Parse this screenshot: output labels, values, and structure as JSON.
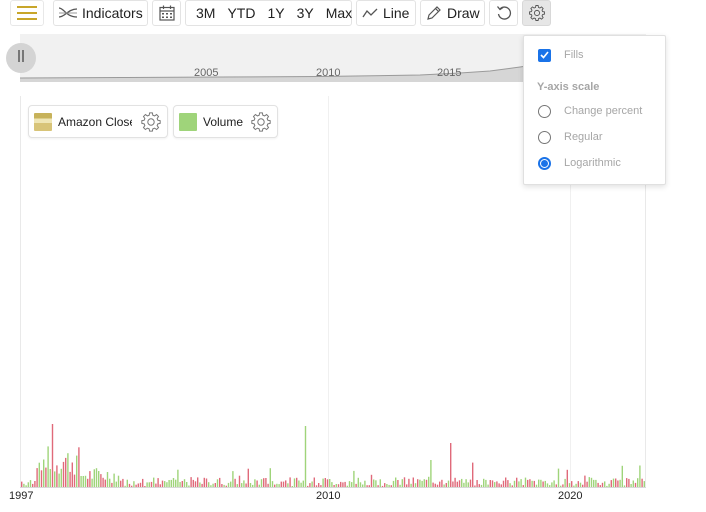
{
  "toolbar": {
    "indicators_label": "Indicators",
    "ranges": [
      "3M",
      "YTD",
      "1Y",
      "3Y",
      "Max"
    ],
    "line_label": "Line",
    "draw_label": "Draw",
    "accent_color": "#c8a62a"
  },
  "navigator": {
    "ticks": [
      "2005",
      "2010",
      "2015"
    ]
  },
  "legend": {
    "amazon_label": "Amazon Close:",
    "volume_label": "Volume"
  },
  "x_axis": {
    "labels": [
      "1997",
      "2010",
      "2020"
    ]
  },
  "settings": {
    "fills_label": "Fills",
    "fills_checked": true,
    "y_axis_title": "Y-axis scale",
    "options": [
      "Change percent",
      "Regular",
      "Logarithmic"
    ],
    "selected": "Logarithmic"
  },
  "colors": {
    "volume_up": "#9fd47a",
    "volume_down": "#e06a7a",
    "checkbox": "#1a73e8"
  }
}
